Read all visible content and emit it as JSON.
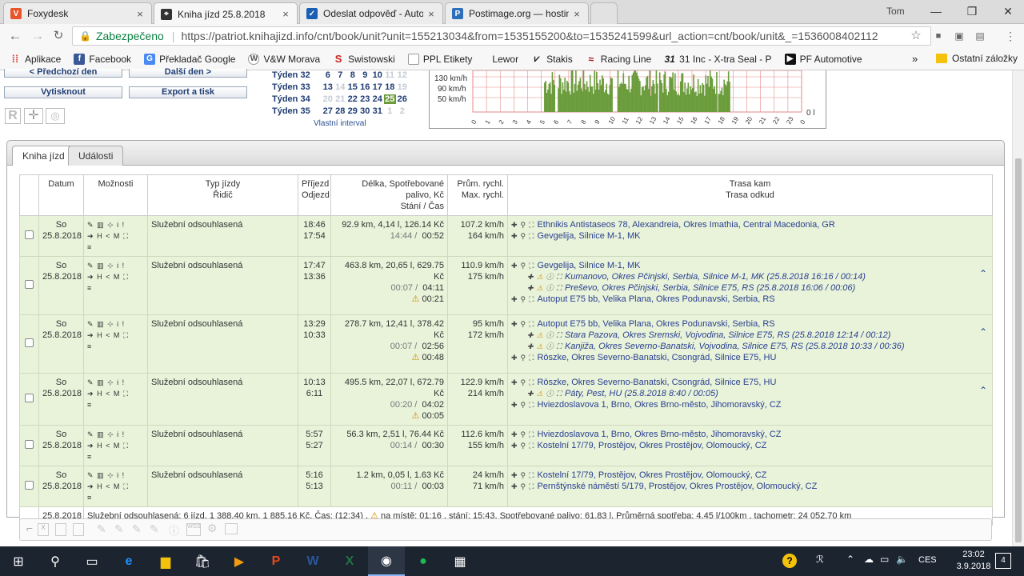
{
  "browser": {
    "tabs": [
      {
        "label": "Foxydesk",
        "icon": "foxydesk-icon",
        "color": "#e8552a"
      },
      {
        "label": "Kniha jízd 25.8.2018",
        "icon": "gps-icon",
        "color": "#333333"
      },
      {
        "label": "Odeslat odpověď - AutoP",
        "icon": "compass-icon",
        "color": "#1a5fb4"
      },
      {
        "label": "Postimage.org — hosting",
        "icon": "postimage-icon",
        "color": "#2d6fbb"
      }
    ],
    "user": "Tom",
    "security_label": "Zabezpečeno",
    "url": "https://patriot.knihajizd.info/cnt/book/unit?unit=155213034&from=1535155200&to=1535241599&url_action=cnt/book/unit&_=1536008402112",
    "bookmarks": [
      {
        "label": "Aplikace",
        "icon": "apps-grid-icon",
        "color": "#d44638"
      },
      {
        "label": "Facebook",
        "icon": "facebook-icon",
        "color": "#3b5998"
      },
      {
        "label": "Překladač Google",
        "icon": "google-translate-icon",
        "color": "#4a8af4"
      },
      {
        "label": "V&W Morava",
        "icon": "vw-icon",
        "color": "#555555"
      },
      {
        "label": "Swistowski",
        "icon": "swistowski-icon",
        "color": "#cc2222"
      },
      {
        "label": "PPL Etikety",
        "icon": "document-icon",
        "color": "#777777"
      },
      {
        "label": "Lewor",
        "icon": "lewor-icon",
        "color": "#444444"
      },
      {
        "label": "Stakis",
        "icon": "stakis-icon",
        "color": "#222222"
      },
      {
        "label": "Racing Line",
        "icon": "racingline-icon",
        "color": "#aa1111"
      },
      {
        "label": "31 Inc - X-tra Seal - P",
        "icon": "31inc-icon",
        "color": "#222222"
      },
      {
        "label": "PF Automotive",
        "icon": "pf-icon",
        "color": "#111111"
      }
    ],
    "other_bookmarks": "Ostatní záložky"
  },
  "controls": {
    "prev_day": "< Předchozí den",
    "next_day": "Další den >",
    "print": "Vytisknout",
    "export": "Export a tisk"
  },
  "calendar": {
    "weeks": [
      {
        "label": "Týden 32",
        "days": [
          "6",
          "7",
          "8",
          "9",
          "10",
          "11",
          "12"
        ],
        "grey": [
          5,
          6
        ]
      },
      {
        "label": "Týden 33",
        "days": [
          "13",
          "14",
          "15",
          "16",
          "17",
          "18",
          "19"
        ],
        "grey": [
          1,
          6
        ]
      },
      {
        "label": "Týden 34",
        "days": [
          "20",
          "21",
          "22",
          "23",
          "24",
          "25",
          "26"
        ],
        "grey": [
          0,
          1
        ],
        "selected": 5
      },
      {
        "label": "Týden 35",
        "days": [
          "27",
          "28",
          "29",
          "30",
          "31",
          "1",
          "2"
        ],
        "grey": [
          5,
          6
        ]
      }
    ],
    "custom_interval": "Vlastní interval"
  },
  "speed_chart": {
    "y_labels": [
      "130 km/h",
      "90 km/h",
      "50 km/h"
    ],
    "right_label": "0 l",
    "hours": [
      "0",
      "1",
      "2",
      "3",
      "4",
      "5",
      "6",
      "7",
      "8",
      "9",
      "10",
      "11",
      "12",
      "13",
      "14",
      "15",
      "16",
      "17",
      "18",
      "19",
      "20",
      "21",
      "22",
      "23",
      "0"
    ],
    "color": "#6b9c3c"
  },
  "page_tabs": [
    "Kniha jízd",
    "Události"
  ],
  "table": {
    "headers": {
      "date": "Datum",
      "options": "Možnosti",
      "type": "Typ jízdy",
      "driver": "Řidič",
      "arrival": "Příjezd",
      "departure": "Odjezd",
      "length": "Délka, Spotřebované palivo, Kč",
      "stops": "Stání / Čas",
      "avg": "Prům. rychl.",
      "max": "Max. rychl.",
      "to": "Trasa kam",
      "from": "Trasa odkud"
    },
    "rows": [
      {
        "day": "So",
        "date": "25.8.2018",
        "type": "Služební odsouhlasená",
        "arr": "18:46",
        "dep": "17:54",
        "length": "92.9 km, 4,14 l, 126.14 Kč",
        "stand": "14:44",
        "time": "00:52",
        "warn": "",
        "avg": "107.2 km/h",
        "max": "164 km/h",
        "to": "Ethnikis Antistaseos 78, Alexandreia, Okres Imathia, Central Macedonia, GR",
        "via": [],
        "from": "Gevgelija, Silnice M-1, MK"
      },
      {
        "day": "So",
        "date": "25.8.2018",
        "type": "Služební odsouhlasená",
        "arr": "17:47",
        "dep": "13:36",
        "length": "463.8 km, 20,65 l, 629.75 Kč",
        "stand": "00:07",
        "time": "04:11",
        "warn": "00:21",
        "avg": "110.9 km/h",
        "max": "175 km/h",
        "to": "Gevgelija, Silnice M-1, MK",
        "via": [
          "Kumanovo, Okres Pčinjski, Serbia, Silnice M-1, MK (25.8.2018 16:16 / 00:14)",
          "Preševo, Okres Pčinjski, Serbia, Silnice E75, RS (25.8.2018 16:06 / 00:06)"
        ],
        "from": "Autoput E75 bb, Velika Plana, Okres Podunavski, Serbia, RS"
      },
      {
        "day": "So",
        "date": "25.8.2018",
        "type": "Služební odsouhlasená",
        "arr": "13:29",
        "dep": "10:33",
        "length": "278.7 km, 12,41 l, 378.42 Kč",
        "stand": "00:07",
        "time": "02:56",
        "warn": "00:48",
        "avg": "95 km/h",
        "max": "172 km/h",
        "to": "Autoput E75 bb, Velika Plana, Okres Podunavski, Serbia, RS",
        "via": [
          "Stara Pazova, Okres Sremski, Vojvodina, Silnice E75, RS (25.8.2018 12:14 / 00:12)",
          "Kanjiža, Okres Severno-Banatski, Vojvodina, Silnice E75, RS (25.8.2018 10:33 / 00:36)"
        ],
        "from": "Röszke, Okres Severno-Banatski, Csongrád, Silnice E75, HU"
      },
      {
        "day": "So",
        "date": "25.8.2018",
        "type": "Služební odsouhlasená",
        "arr": "10:13",
        "dep": "6:11",
        "length": "495.5 km, 22,07 l, 672.79 Kč",
        "stand": "00:20",
        "time": "04:02",
        "warn": "00:05",
        "avg": "122.9 km/h",
        "max": "214 km/h",
        "to": "Röszke, Okres Severno-Banatski, Csongrád, Silnice E75, HU",
        "via": [
          "Páty, Pest, HU (25.8.2018 8:40 / 00:05)"
        ],
        "from": "Hviezdoslavova 1, Brno, Okres Brno-město, Jihomoravský, CZ"
      },
      {
        "day": "So",
        "date": "25.8.2018",
        "type": "Služební odsouhlasená",
        "arr": "5:57",
        "dep": "5:27",
        "length": "56.3 km, 2,51 l, 76.44 Kč",
        "stand": "00:14",
        "time": "00:30",
        "warn": "",
        "avg": "112.6 km/h",
        "max": "155 km/h",
        "to": "Hviezdoslavova 1, Brno, Okres Brno-město, Jihomoravský, CZ",
        "via": [],
        "from": "Kostelní 17/79, Prostějov, Okres Prostějov, Olomoucký, CZ"
      },
      {
        "day": "So",
        "date": "25.8.2018",
        "type": "Služební odsouhlasená",
        "arr": "5:16",
        "dep": "5:13",
        "length": "1.2 km, 0,05 l, 1.63 Kč",
        "stand": "00:11",
        "time": "00:03",
        "warn": "",
        "avg": "24 km/h",
        "max": "71 km/h",
        "to": "Kostelní 17/79, Prostějov, Okres Prostějov, Olomoucký, CZ",
        "via": [],
        "from": "Pernštýnské náměstí 5/179, Prostějov, Okres Prostějov, Olomoucký, CZ"
      }
    ],
    "footer_date": "25.8.2018",
    "footer_summary_a": "Služební odsouhlasená: 6 jízd, 1 388,40 km, 1 885,16 Kč, Čas: (12:34) ,",
    "footer_summary_b": "na místě:  01:16 , stání: 15:43, Spotřebované palivo: 61,83 l, Průměrná spotřeba: 4,45 l/100km , tachometr: 24 052,70 km"
  },
  "taskbar": {
    "lang": "CES",
    "time": "23:02",
    "date": "3.9.2018",
    "notif_count": "4"
  }
}
